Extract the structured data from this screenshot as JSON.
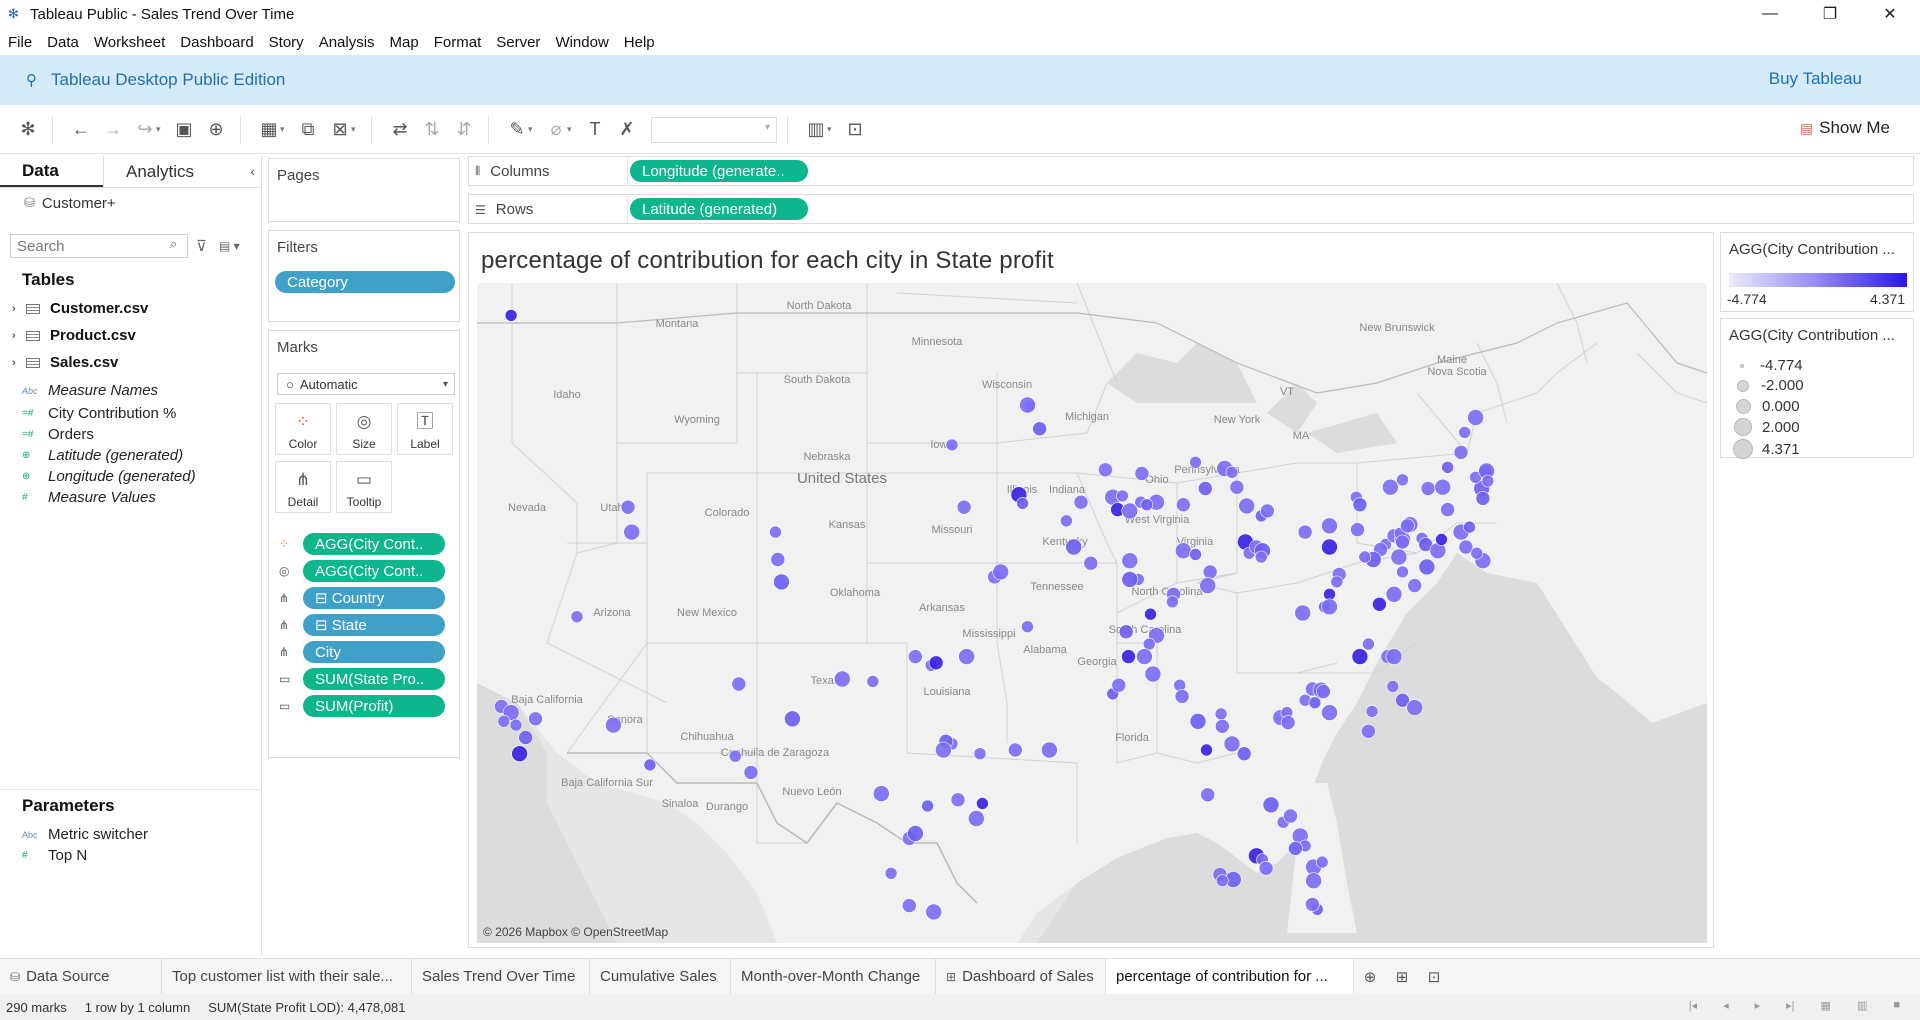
{
  "window": {
    "title": "Tableau Public - Sales Trend Over Time",
    "controls": [
      "—",
      "❐",
      "✕"
    ]
  },
  "menu": [
    "File",
    "Data",
    "Worksheet",
    "Dashboard",
    "Story",
    "Analysis",
    "Map",
    "Format",
    "Server",
    "Window",
    "Help"
  ],
  "banner": {
    "edition": "Tableau Desktop Public Edition",
    "buy": "Buy Tableau"
  },
  "toolbar": {
    "show_me": "Show Me"
  },
  "data_pane": {
    "tabs": [
      "Data",
      "Analytics"
    ],
    "data_source": "Customer+",
    "search_placeholder": "Search",
    "tables_heading": "Tables",
    "tables": [
      "Customer.csv",
      "Product.csv",
      "Sales.csv"
    ],
    "fields": [
      {
        "name": "Measure Names",
        "type": "Abc",
        "italic": true
      },
      {
        "name": "City Contribution %",
        "type": "#",
        "italic": false
      },
      {
        "name": "Orders",
        "type": "#",
        "italic": false
      },
      {
        "name": "Latitude (generated)",
        "type": "geo",
        "italic": true
      },
      {
        "name": "Longitude (generated)",
        "type": "geo",
        "italic": true
      },
      {
        "name": "Measure Values",
        "type": "#",
        "italic": true
      }
    ],
    "parameters_heading": "Parameters",
    "parameters": [
      {
        "name": "Metric switcher",
        "type": "Abc"
      },
      {
        "name": "Top N",
        "type": "#"
      }
    ]
  },
  "shelves": {
    "pages": "Pages",
    "filters": "Filters",
    "filter_pills": [
      "Category"
    ],
    "marks": "Marks",
    "mark_type": "Automatic",
    "mark_buttons": [
      "Color",
      "Size",
      "Label",
      "Detail",
      "Tooltip"
    ],
    "mark_pills": [
      {
        "icon": "color",
        "label": "AGG(City Cont..",
        "color": "green"
      },
      {
        "icon": "size",
        "label": "AGG(City Cont..",
        "color": "green"
      },
      {
        "icon": "detail",
        "label": "⊟ Country",
        "color": "blue"
      },
      {
        "icon": "detail",
        "label": "⊟ State",
        "color": "blue"
      },
      {
        "icon": "detail",
        "label": "City",
        "color": "blue"
      },
      {
        "icon": "tooltip",
        "label": "SUM(State Pro..",
        "color": "green"
      },
      {
        "icon": "tooltip",
        "label": "SUM(Profit)",
        "color": "green"
      }
    ],
    "columns_label": "Columns",
    "columns_pill": "Longitude (generate..",
    "rows_label": "Rows",
    "rows_pill": "Latitude (generated)"
  },
  "view": {
    "title": "percentage of contribution for each city in State profit",
    "attribution": "© 2026 Mapbox © OpenStreetMap",
    "map_labels": [
      "Montana",
      "North Dakota",
      "Minnesota",
      "Wisconsin",
      "South Dakota",
      "Idaho",
      "Wyoming",
      "Iowa",
      "Nebraska",
      "United States",
      "Nevada",
      "Utah",
      "Colorado",
      "Kansas",
      "Missouri",
      "Illinois",
      "Indiana",
      "Ohio",
      "Michigan",
      "Pennsylvania",
      "New York",
      "Maine",
      "New Brunswick",
      "Nova Scotia",
      "VT",
      "MA",
      "West Virginia",
      "Kentucky",
      "Tennessee",
      "Virginia",
      "Arizona",
      "New Mexico",
      "Oklahoma",
      "Arkansas",
      "North Carolina",
      "South Carolina",
      "Mississippi",
      "Alabama",
      "Georgia",
      "Texas",
      "Louisiana",
      "Florida",
      "Baja California",
      "Sonora",
      "Chihuahua",
      "Coahuila de Zaragoza",
      "Baja California Sur",
      "Sinaloa",
      "Durango",
      "Nuevo León"
    ]
  },
  "legends": {
    "color_title": "AGG(City Contribution ...",
    "color_min": "-4.774",
    "color_max": "4.371",
    "size_title": "AGG(City Contribution ...",
    "size_values": [
      "-4.774",
      "-2.000",
      "0.000",
      "2.000",
      "4.371"
    ]
  },
  "sheet_tabs": [
    {
      "label": "Data Source",
      "icon": "db"
    },
    {
      "label": "Top customer list with their sale...",
      "icon": ""
    },
    {
      "label": "Sales Trend Over Time",
      "icon": ""
    },
    {
      "label": "Cumulative Sales",
      "icon": ""
    },
    {
      "label": "Month-over-Month Change",
      "icon": ""
    },
    {
      "label": "Dashboard of Sales",
      "icon": "dash"
    },
    {
      "label": "percentage of contribution for ...",
      "icon": "",
      "active": true
    }
  ],
  "status": {
    "marks": "290 marks",
    "layout": "1 row by 1 column",
    "sum": "SUM(State Profit LOD): 4,478,081"
  }
}
